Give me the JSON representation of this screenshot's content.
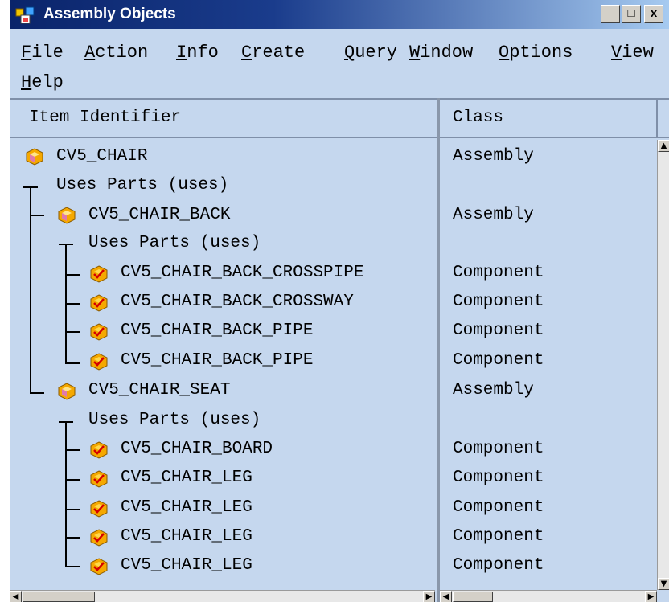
{
  "window": {
    "title": "Assembly Objects",
    "controls": {
      "minimize": "_",
      "maximize": "□",
      "close": "x"
    }
  },
  "menu": [
    {
      "mnemonic": "F",
      "rest": "ile"
    },
    {
      "mnemonic": "A",
      "rest": "ction"
    },
    {
      "mnemonic": "I",
      "rest": "nfo"
    },
    {
      "mnemonic": "C",
      "rest": "reate"
    },
    {
      "mnemonic": "Q",
      "rest": "uery"
    },
    {
      "mnemonic": "W",
      "rest": "indow"
    },
    {
      "mnemonic": "O",
      "rest": "ptions"
    },
    {
      "mnemonic": "V",
      "rest": "iew"
    },
    {
      "mnemonic": "H",
      "rest": "elp"
    }
  ],
  "columns": {
    "item": "Item Identifier",
    "class": "Class"
  },
  "rows": [
    {
      "label": "CV5_CHAIR",
      "class": "Assembly"
    },
    {
      "label": "Uses Parts (uses)",
      "class": ""
    },
    {
      "label": "CV5_CHAIR_BACK",
      "class": "Assembly"
    },
    {
      "label": "Uses Parts (uses)",
      "class": ""
    },
    {
      "label": "CV5_CHAIR_BACK_CROSSPIPE",
      "class": "Component"
    },
    {
      "label": "CV5_CHAIR_BACK_CROSSWAY",
      "class": "Component"
    },
    {
      "label": "CV5_CHAIR_BACK_PIPE",
      "class": "Component"
    },
    {
      "label": "CV5_CHAIR_BACK_PIPE",
      "class": "Component"
    },
    {
      "label": "CV5_CHAIR_SEAT",
      "class": "Assembly"
    },
    {
      "label": "Uses Parts (uses)",
      "class": ""
    },
    {
      "label": "CV5_CHAIR_BOARD",
      "class": "Component"
    },
    {
      "label": "CV5_CHAIR_LEG",
      "class": "Component"
    },
    {
      "label": "CV5_CHAIR_LEG",
      "class": "Component"
    },
    {
      "label": "CV5_CHAIR_LEG",
      "class": "Component"
    },
    {
      "label": "CV5_CHAIR_LEG",
      "class": "Component"
    }
  ],
  "icons": {
    "assembly": "assembly-cube-icon",
    "component": "component-cube-icon"
  },
  "colors": {
    "background": "#c5d7ee",
    "titlebar": "#0a246a",
    "icon_orange": "#f5a800",
    "icon_pink": "#d46aa8"
  }
}
